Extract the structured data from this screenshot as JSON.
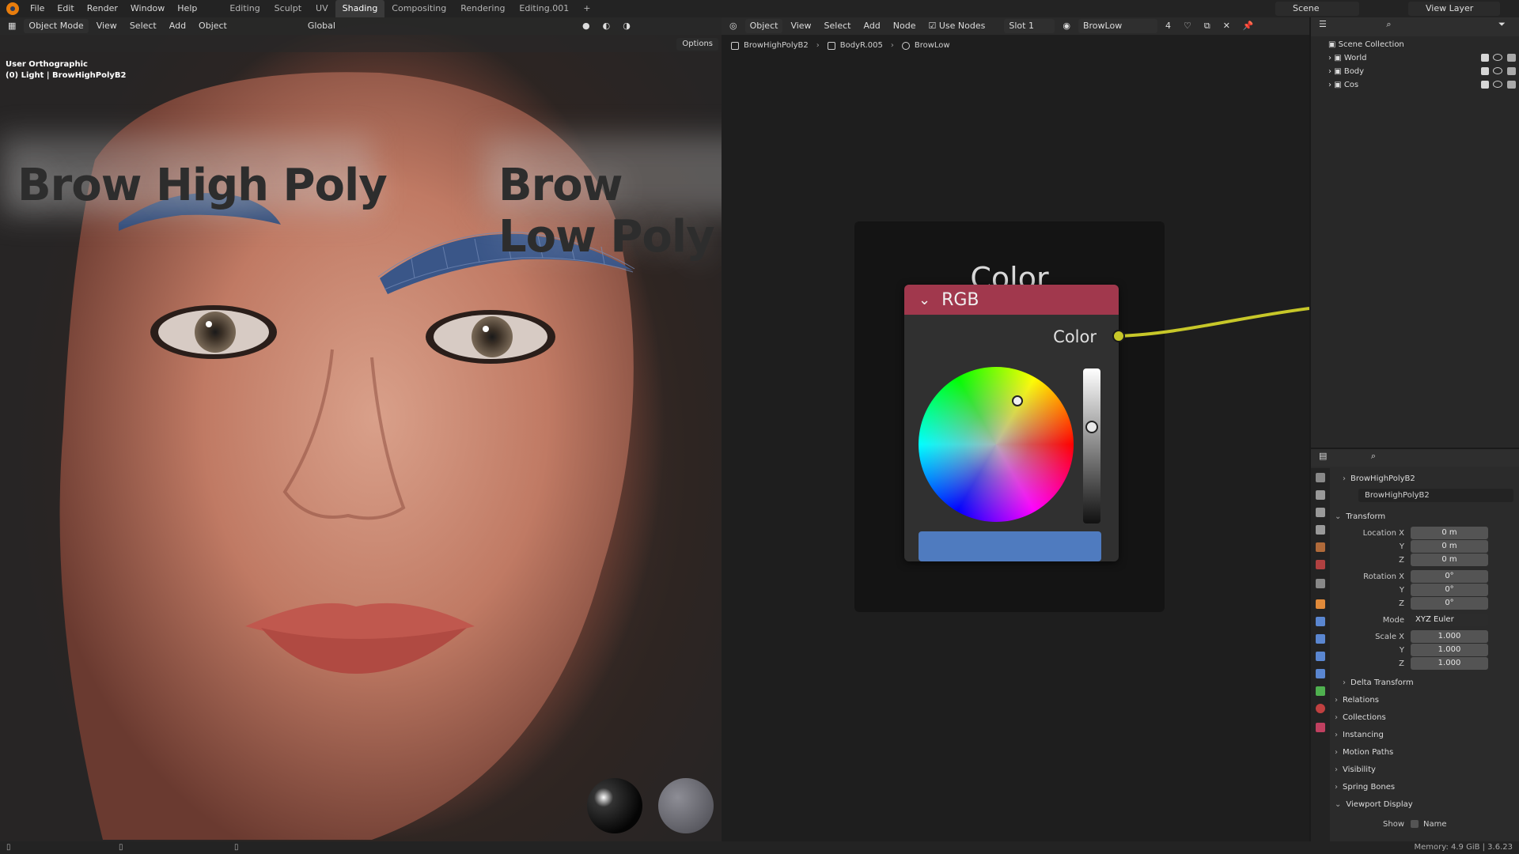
{
  "topbar": {
    "menus": [
      "File",
      "Edit",
      "Render",
      "Window",
      "Help"
    ],
    "workspaces": [
      "Editing",
      "Sculpt",
      "UV",
      "Shading",
      "Compositing",
      "Rendering",
      "Editing.001"
    ],
    "active_workspace": "Shading",
    "scene": "Scene",
    "view_layer": "View Layer"
  },
  "viewport": {
    "mode": "Object Mode",
    "menus": [
      "View",
      "Select",
      "Add",
      "Object"
    ],
    "orientation": "Global",
    "options_label": "Options",
    "view_name": "User Orthographic",
    "object_info": "(0) Light | BrowHighPolyB2",
    "label_left": "Brow High Poly",
    "label_right": "Brow Low Poly"
  },
  "node_editor": {
    "object_btn": "Object",
    "menus": [
      "View",
      "Select",
      "Add",
      "Node"
    ],
    "use_nodes_label": "Use Nodes",
    "slot": "Slot 1",
    "material": "BrowLow",
    "user_count": "4",
    "breadcrumb": [
      "BrowHighPolyB2",
      "BodyR.005",
      "BrowLow"
    ],
    "frame_title": "Color",
    "node_title": "RGB",
    "output_label": "Color",
    "swatch_color": "#4f7bbf",
    "socket_color": "#c7c729",
    "header_color": "#a1384d"
  },
  "outliner": {
    "root": "Scene Collection",
    "items": [
      "World",
      "Body",
      "Cos"
    ]
  },
  "properties": {
    "object_name": "BrowHighPolyB2",
    "data_name": "BrowHighPolyB2",
    "transform_label": "Transform",
    "location_label": "Location X",
    "rotation_label": "Rotation X",
    "scale_label": "Scale X",
    "axis_y": "Y",
    "axis_z": "Z",
    "location": [
      "0 m",
      "0 m",
      "0 m"
    ],
    "rotation": [
      "0°",
      "0°",
      "0°"
    ],
    "mode_label": "Mode",
    "mode_value": "XYZ Euler",
    "scale": [
      "1.000",
      "1.000",
      "1.000"
    ],
    "panels": [
      "Delta Transform",
      "Relations",
      "Collections",
      "Instancing",
      "Motion Paths",
      "Visibility",
      "Spring Bones",
      "Viewport Display"
    ],
    "show_label": "Show",
    "name_label": "Name"
  },
  "statusbar": {
    "memory": "Memory: 4.9 GiB | 3.6.23"
  }
}
